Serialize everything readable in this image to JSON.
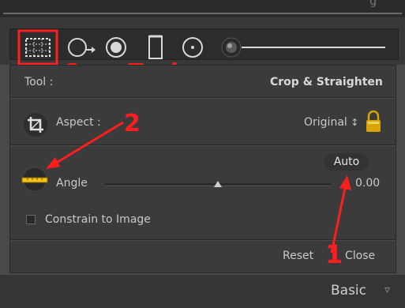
{
  "annotations": {
    "crop_tool_label": "Crop Tool",
    "marker_2": "2",
    "marker_1": "1",
    "arrow_color": "#ff1e1e"
  },
  "toolbar": {
    "icons": [
      "crop-overlay-icon",
      "spot-removal-icon",
      "red-eye-icon",
      "graduated-filter-icon",
      "radial-filter-icon",
      "adjustment-brush-icon"
    ]
  },
  "panel": {
    "tool_label": "Tool :",
    "tool_value": "Crop & Straighten",
    "aspect_label": "Aspect :",
    "aspect_value": "Original",
    "aspect_arrows": "↕",
    "angle_label": "Angle",
    "angle_value": "0.00",
    "auto_label": "Auto",
    "constrain_label": "Constrain to Image",
    "constrain_checked": false,
    "reset_label": "Reset",
    "close_label": "Close"
  },
  "footer": {
    "basic_label": "Basic",
    "collapse_icon": "▿"
  },
  "colors": {
    "panel_bg": "#3b3b3b",
    "toolbar_bg": "#2d2d2d",
    "ruler_yellow": "#f2c418",
    "lock_gold": "#d9a300"
  }
}
